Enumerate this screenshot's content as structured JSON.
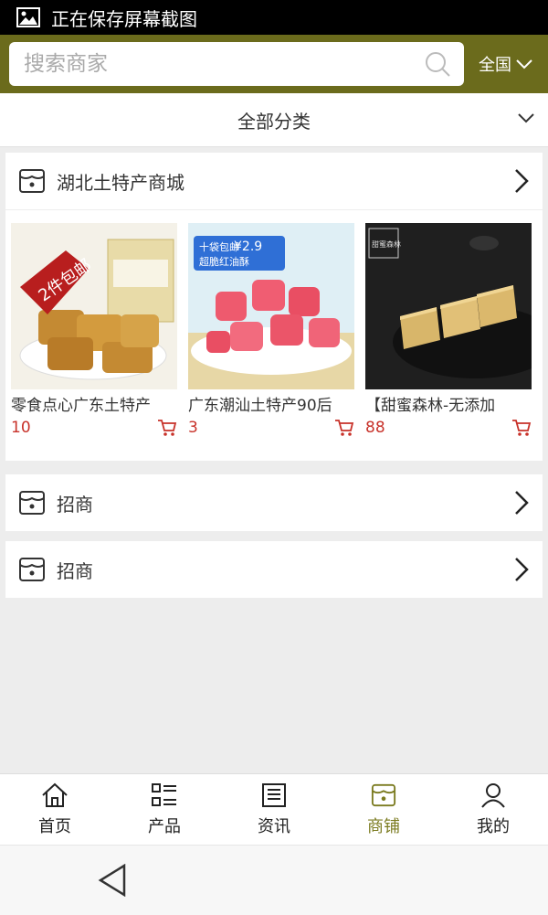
{
  "status_bar": {
    "text": "正在保存屏幕截图"
  },
  "search": {
    "placeholder": "搜索商家",
    "region": "全国"
  },
  "category_bar": {
    "label": "全部分类"
  },
  "shops": [
    {
      "title": "湖北土特产商城",
      "products": [
        {
          "name": "零食点心广东土特产",
          "price": "10",
          "badge": "2件包邮"
        },
        {
          "name": "广东潮汕土特产90后",
          "price": "3",
          "badge": "十袋包邮",
          "badge_price": "¥2.9",
          "badge_sub": "超脆红油酥"
        },
        {
          "name": "【甜蜜森林-无添加",
          "price": "88",
          "badge": "甜蜜森林"
        }
      ]
    },
    {
      "title": "招商"
    },
    {
      "title": "招商"
    }
  ],
  "tabs": [
    {
      "label": "首页",
      "icon": "home-icon"
    },
    {
      "label": "产品",
      "icon": "product-list-icon"
    },
    {
      "label": "资讯",
      "icon": "news-icon"
    },
    {
      "label": "商铺",
      "icon": "shop-icon",
      "active": true
    },
    {
      "label": "我的",
      "icon": "profile-icon"
    }
  ],
  "colors": {
    "accent": "#6b6b1c",
    "price": "#c8322a",
    "active_tab": "#7b7b20"
  }
}
